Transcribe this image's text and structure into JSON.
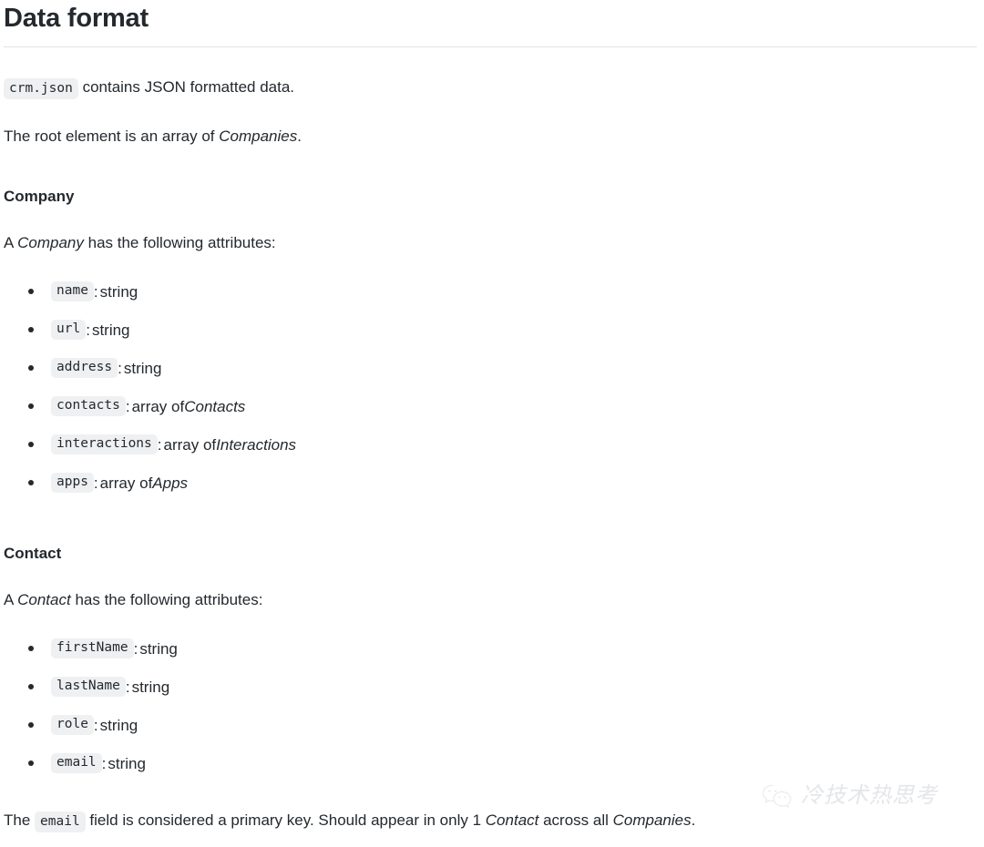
{
  "document": {
    "title": "Data format",
    "intro": {
      "code": "crm.json",
      "text": " contains JSON formatted data."
    },
    "root_element": {
      "before": "The root element is an array of ",
      "italic": "Companies",
      "after": "."
    }
  },
  "sections": [
    {
      "heading": "Company",
      "lead": {
        "before": "A ",
        "italic": "Company",
        "after": " has the following attributes:"
      },
      "attributes": [
        {
          "name": "name",
          "separator": " : ",
          "type": "string",
          "type_italic": ""
        },
        {
          "name": "url",
          "separator": " : ",
          "type": "string",
          "type_italic": ""
        },
        {
          "name": "address",
          "separator": " : ",
          "type": "string",
          "type_italic": ""
        },
        {
          "name": "contacts",
          "separator": " : ",
          "type": "array of ",
          "type_italic": "Contacts"
        },
        {
          "name": "interactions",
          "separator": " : ",
          "type": "array of ",
          "type_italic": "Interactions"
        },
        {
          "name": "apps",
          "separator": " : ",
          "type": "array of ",
          "type_italic": "Apps"
        }
      ]
    },
    {
      "heading": "Contact",
      "lead": {
        "before": "A ",
        "italic": "Contact",
        "after": " has the following attributes:"
      },
      "attributes": [
        {
          "name": "firstName",
          "separator": " : ",
          "type": "string",
          "type_italic": ""
        },
        {
          "name": "lastName",
          "separator": " : ",
          "type": "string",
          "type_italic": ""
        },
        {
          "name": "role",
          "separator": " : ",
          "type": "string",
          "type_italic": ""
        },
        {
          "name": "email",
          "separator": " : ",
          "type": "string",
          "type_italic": ""
        }
      ]
    }
  ],
  "primary_key_note": {
    "part1": "The ",
    "code": "email",
    "part2": " field is considered a primary key. Should appear in only 1 ",
    "italic1": "Contact",
    "part3": " across all ",
    "italic2": "Companies",
    "part4": "."
  },
  "watermark": {
    "icon": "wechat-icon",
    "text": "冷技术热思考"
  },
  "colors": {
    "text": "#24292e",
    "chip_background": "#eff0f2",
    "rule": "#dfe2e5",
    "watermark_text": "#e4e6e9",
    "page_background": "#ffffff"
  }
}
